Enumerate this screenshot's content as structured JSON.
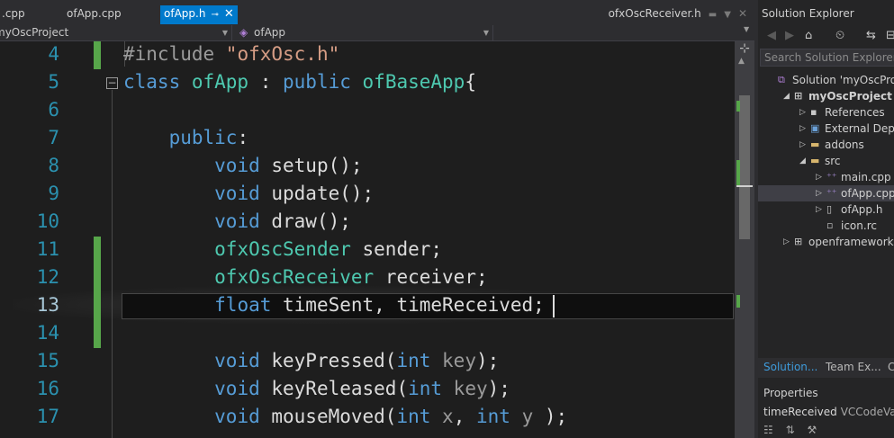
{
  "tabs": {
    "items": [
      {
        "label": ".cpp"
      },
      {
        "label": "ofApp.cpp"
      },
      {
        "label": "ofApp.h",
        "active": true
      }
    ],
    "pin_glyph": "⊸",
    "close_glyph": "✕",
    "right_label": "ofxOscReceiver.h"
  },
  "navbar": {
    "project_combo": "myOscProject",
    "scope_combo": "ofApp",
    "scope_icon": "class-icon"
  },
  "editor": {
    "current_line": "13",
    "lines": [
      {
        "num": "4",
        "tokens": [
          {
            "t": "#include ",
            "c": "pp"
          },
          {
            "t": "\"ofxOsc.h\"",
            "c": "str"
          }
        ]
      },
      {
        "num": "5",
        "tokens": [
          {
            "t": "class ",
            "c": "kw"
          },
          {
            "t": "ofApp",
            "c": "ty"
          },
          {
            "t": " : ",
            "c": "pl"
          },
          {
            "t": "public ",
            "c": "kw"
          },
          {
            "t": "ofBaseApp",
            "c": "ty"
          },
          {
            "t": "{",
            "c": "pl"
          }
        ]
      },
      {
        "num": "6",
        "tokens": []
      },
      {
        "num": "7",
        "tokens": [
          {
            "t": "    ",
            "c": "pl"
          },
          {
            "t": "public",
            "c": "kw"
          },
          {
            "t": ":",
            "c": "pl"
          }
        ]
      },
      {
        "num": "8",
        "tokens": [
          {
            "t": "        ",
            "c": "pl"
          },
          {
            "t": "void ",
            "c": "kw"
          },
          {
            "t": "setup();",
            "c": "pl"
          }
        ]
      },
      {
        "num": "9",
        "tokens": [
          {
            "t": "        ",
            "c": "pl"
          },
          {
            "t": "void ",
            "c": "kw"
          },
          {
            "t": "update();",
            "c": "pl"
          }
        ]
      },
      {
        "num": "10",
        "tokens": [
          {
            "t": "        ",
            "c": "pl"
          },
          {
            "t": "void ",
            "c": "kw"
          },
          {
            "t": "draw();",
            "c": "pl"
          }
        ]
      },
      {
        "num": "11",
        "tokens": [
          {
            "t": "        ",
            "c": "pl"
          },
          {
            "t": "ofxOscSender",
            "c": "ty"
          },
          {
            "t": " sender;",
            "c": "pl"
          }
        ]
      },
      {
        "num": "12",
        "tokens": [
          {
            "t": "        ",
            "c": "pl"
          },
          {
            "t": "ofxOscReceiver",
            "c": "ty"
          },
          {
            "t": " receiver;",
            "c": "pl"
          }
        ]
      },
      {
        "num": "13",
        "tokens": [
          {
            "t": "        ",
            "c": "pl"
          },
          {
            "t": "float ",
            "c": "kw"
          },
          {
            "t": "timeSent, timeReceived;",
            "c": "pl"
          }
        ]
      },
      {
        "num": "14",
        "tokens": []
      },
      {
        "num": "15",
        "tokens": [
          {
            "t": "        ",
            "c": "pl"
          },
          {
            "t": "void ",
            "c": "kw"
          },
          {
            "t": "keyPressed(",
            "c": "pl"
          },
          {
            "t": "int ",
            "c": "kw"
          },
          {
            "t": "key",
            "c": "par"
          },
          {
            "t": ");",
            "c": "pl"
          }
        ]
      },
      {
        "num": "16",
        "tokens": [
          {
            "t": "        ",
            "c": "pl"
          },
          {
            "t": "void ",
            "c": "kw"
          },
          {
            "t": "keyReleased(",
            "c": "pl"
          },
          {
            "t": "int ",
            "c": "kw"
          },
          {
            "t": "key",
            "c": "par"
          },
          {
            "t": ");",
            "c": "pl"
          }
        ]
      },
      {
        "num": "17",
        "tokens": [
          {
            "t": "        ",
            "c": "pl"
          },
          {
            "t": "void ",
            "c": "kw"
          },
          {
            "t": "mouseMoved(",
            "c": "pl"
          },
          {
            "t": "int ",
            "c": "kw"
          },
          {
            "t": "x",
            "c": "par"
          },
          {
            "t": ", ",
            "c": "pl"
          },
          {
            "t": "int ",
            "c": "kw"
          },
          {
            "t": "y",
            "c": "par"
          },
          {
            "t": " );",
            "c": "pl"
          }
        ]
      }
    ],
    "changed_lines": [
      "4",
      "11",
      "12",
      "13",
      "14"
    ],
    "colors": {
      "keyword": "#569cd6",
      "type": "#4ec9b0",
      "string": "#d69d85",
      "line_number": "#2b91af",
      "change_bar": "#57a64a"
    }
  },
  "solution_explorer": {
    "title": "Solution Explorer",
    "search_placeholder": "Search Solution Explorer (",
    "toolbar_icons": [
      "back-icon",
      "forward-icon",
      "home-icon",
      "history-icon",
      "sync-icon",
      "collapse-icon"
    ],
    "tree": [
      {
        "label": "Solution 'myOscProje",
        "icon": "solution-icon",
        "expander": ""
      },
      {
        "label": "myOscProject",
        "icon": "project-icon",
        "expander": "expanded",
        "bold": true
      },
      {
        "label": "References",
        "icon": "references-icon",
        "expander": "collapsed"
      },
      {
        "label": "External Deper",
        "icon": "external-deps-icon",
        "expander": "collapsed"
      },
      {
        "label": "addons",
        "icon": "folder-icon",
        "expander": "collapsed"
      },
      {
        "label": "src",
        "icon": "folder-icon",
        "expander": "expanded"
      },
      {
        "label": "main.cpp",
        "icon": "cpp-file-icon",
        "expander": "collapsed"
      },
      {
        "label": "ofApp.cpp",
        "icon": "cpp-file-icon",
        "expander": "collapsed",
        "selected": true
      },
      {
        "label": "ofApp.h",
        "icon": "header-file-icon",
        "expander": "collapsed"
      },
      {
        "label": "icon.rc",
        "icon": "resource-file-icon",
        "expander": ""
      },
      {
        "label": "openframeworksLi",
        "icon": "project-icon",
        "expander": "collapsed"
      }
    ],
    "bottom_tabs": [
      {
        "label": "Solution...",
        "active": true
      },
      {
        "label": "Team Ex..."
      },
      {
        "label": "C"
      }
    ]
  },
  "properties": {
    "title": "Properties",
    "object_name": "timeReceived",
    "object_type": "VCCodeVa"
  }
}
